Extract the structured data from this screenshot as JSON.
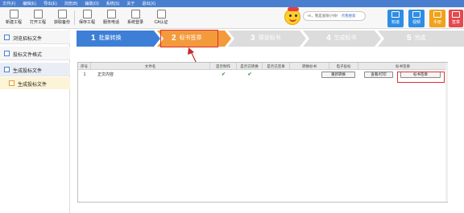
{
  "menu": [
    "文件(F)",
    "编辑(E)",
    "导出(E)",
    "浏览(B)",
    "辅助(O)",
    "系统(S)",
    "关于",
    "退出(X)"
  ],
  "toolbar": {
    "buttons": [
      "新建工程",
      "打开工程",
      "获取备份",
      "保存工程",
      "服务电话",
      "系统登录",
      "CA认证"
    ],
    "search_text": "Hi，我是爱眼小帅！",
    "search_link": "点我搜索",
    "quick": [
      {
        "label": "知道",
        "color": "#2f8de4"
      },
      {
        "label": "视频",
        "color": "#2f8de4"
      },
      {
        "label": "手册",
        "color": "#f0a21a"
      },
      {
        "label": "签章",
        "color": "#e5484d"
      }
    ]
  },
  "sidebar": {
    "items": [
      "浏览招标文件",
      "投标文件格式",
      "生成投标文件"
    ],
    "sub_item": "生成投标文件"
  },
  "steps": [
    {
      "num": "1",
      "label": "批量转换",
      "state": "done",
      "color": "#3d7fd6"
    },
    {
      "num": "2",
      "label": "标书签章",
      "state": "active",
      "color": "#f39a3b"
    },
    {
      "num": "3",
      "label": "预览标书",
      "state": "pending",
      "color": "#dddddd"
    },
    {
      "num": "4",
      "label": "生成标书",
      "state": "pending",
      "color": "#dddddd"
    },
    {
      "num": "5",
      "label": "完成",
      "state": "pending",
      "color": "#dddddd"
    }
  ],
  "table": {
    "headers": [
      "序号",
      "文件名",
      "是否制作",
      "是否已转换",
      "是否已签章",
      "转换标书",
      "电子投标",
      "标书签章"
    ],
    "rows": [
      {
        "index": "1",
        "name": "正文内容",
        "made": "✔",
        "converted": "✔",
        "signed": "",
        "convert_btn": "重新转换",
        "view_btn": "查看/打印",
        "sign_btn": "标书签章"
      }
    ]
  }
}
